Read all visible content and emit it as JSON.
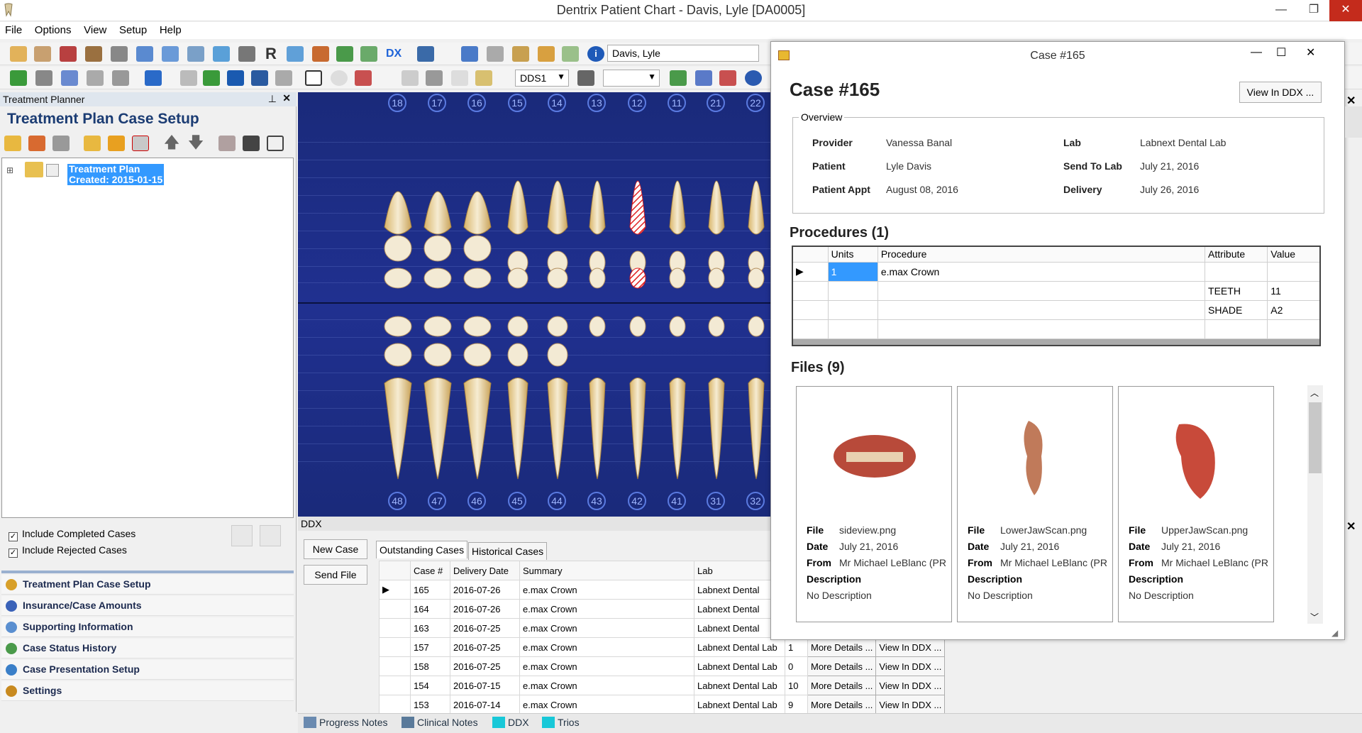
{
  "window": {
    "title": "Dentrix Patient Chart - Davis, Lyle [DA0005]"
  },
  "menu": [
    "File",
    "Options",
    "View",
    "Setup",
    "Help"
  ],
  "toolbar": {
    "patient_combo": "Davis, Lyle",
    "provider_combo": "DDS1"
  },
  "left_panel": {
    "header": "Treatment Planner",
    "title": "Treatment Plan Case Setup",
    "tree_item": {
      "line1": "Treatment Plan",
      "line2": "Created: 2015-01-15"
    },
    "include_completed": "Include Completed Cases",
    "include_rejected": "Include Rejected Cases",
    "nav": [
      {
        "label": "Treatment Plan Case Setup",
        "color": "#d8a02a"
      },
      {
        "label": "Insurance/Case Amounts",
        "color": "#3a62b8"
      },
      {
        "label": "Supporting Information",
        "color": "#5a8fd0"
      },
      {
        "label": "Case Status History",
        "color": "#4a9a4a"
      },
      {
        "label": "Case Presentation Setup",
        "color": "#3a7fc8"
      },
      {
        "label": "Settings",
        "color": "#c88a20"
      }
    ]
  },
  "chart": {
    "upper_numbers": [
      "18",
      "17",
      "16",
      "15",
      "14",
      "13",
      "12",
      "11",
      "21",
      "22"
    ],
    "lower_numbers": [
      "48",
      "47",
      "46",
      "45",
      "44",
      "43",
      "42",
      "41",
      "31",
      "32"
    ]
  },
  "ddx": {
    "header": "DDX",
    "new_case": "New Case",
    "send_file": "Send File",
    "tabs": [
      "Outstanding Cases",
      "Historical Cases"
    ],
    "columns": [
      "Case #",
      "Delivery Date",
      "Summary",
      "Lab"
    ],
    "more_label": "More Details ...",
    "view_label": "View In DDX ...",
    "rows": [
      {
        "case": "165",
        "date": "2016-07-26",
        "summary": "e.max Crown",
        "lab": "Labnext Dental",
        "n": ""
      },
      {
        "case": "164",
        "date": "2016-07-26",
        "summary": "e.max Crown",
        "lab": "Labnext Dental",
        "n": ""
      },
      {
        "case": "163",
        "date": "2016-07-25",
        "summary": "e.max Crown",
        "lab": "Labnext Dental",
        "n": ""
      },
      {
        "case": "157",
        "date": "2016-07-25",
        "summary": "e.max Crown",
        "lab": "Labnext Dental Lab",
        "n": "1"
      },
      {
        "case": "158",
        "date": "2016-07-25",
        "summary": "e.max Crown",
        "lab": "Labnext Dental Lab",
        "n": "0"
      },
      {
        "case": "154",
        "date": "2016-07-15",
        "summary": "e.max Crown",
        "lab": "Labnext Dental Lab",
        "n": "10"
      },
      {
        "case": "153",
        "date": "2016-07-14",
        "summary": "e.max Crown",
        "lab": "Labnext Dental Lab",
        "n": "9"
      }
    ]
  },
  "dialog": {
    "window_title": "Case #165",
    "heading": "Case #165",
    "view_in_ddx": "View In DDX ...",
    "overview_label": "Overview",
    "overview": {
      "provider_k": "Provider",
      "provider_v": "Vanessa Banal",
      "patient_k": "Patient",
      "patient_v": "Lyle Davis",
      "appt_k": "Patient Appt",
      "appt_v": "August 08, 2016",
      "lab_k": "Lab",
      "lab_v": "Labnext Dental Lab",
      "send_k": "Send To Lab",
      "send_v": "July 21, 2016",
      "delivery_k": "Delivery",
      "delivery_v": "July 26, 2016"
    },
    "procedures_title": "Procedures (1)",
    "proc_columns": [
      "Units",
      "Procedure",
      "Attribute",
      "Value"
    ],
    "proc_rows": [
      {
        "units": "1",
        "procedure": "e.max Crown",
        "attribute": "",
        "value": ""
      },
      {
        "units": "",
        "procedure": "",
        "attribute": "TEETH",
        "value": "11"
      },
      {
        "units": "",
        "procedure": "",
        "attribute": "SHADE",
        "value": "A2"
      }
    ],
    "files_title": "Files (9)",
    "file_labels": {
      "file": "File",
      "date": "Date",
      "from": "From",
      "description": "Description"
    },
    "files": [
      {
        "name": "sideview.png",
        "date": "July 21, 2016",
        "from": "Mr Michael LeBlanc (PRA",
        "description": "No Description"
      },
      {
        "name": "LowerJawScan.png",
        "date": "July 21, 2016",
        "from": "Mr Michael LeBlanc (PRA",
        "description": "No Description"
      },
      {
        "name": "UpperJawScan.png",
        "date": "July 21, 2016",
        "from": "Mr Michael LeBlanc (PRA",
        "description": "No Description"
      }
    ]
  },
  "statusbar": [
    "Progress Notes",
    "Clinical Notes",
    "DDX",
    "Trios"
  ]
}
